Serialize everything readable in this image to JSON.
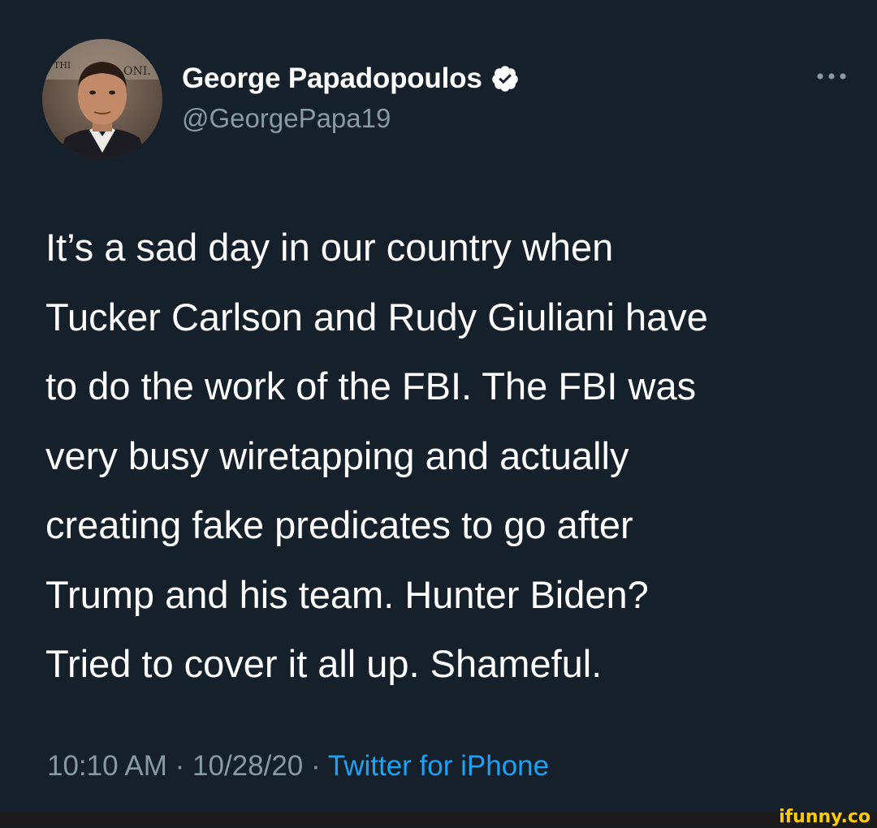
{
  "tweet": {
    "display_name": "George Papadopoulos",
    "handle": "@GeorgePapa19",
    "verified": true,
    "avatar_icon": "profile-photo",
    "more_icon": "more-dots-icon",
    "text_lines": [
      "It’s a sad day in our country when",
      "Tucker Carlson and Rudy Giuliani have",
      "to do the work of the FBI. The FBI was",
      "very busy wiretapping and actually",
      "creating fake predicates to go after",
      "Trump and his team. Hunter Biden?",
      "Tried to cover it all up. Shameful."
    ],
    "time": "10:10 AM",
    "separator": "·",
    "date": "10/28/20",
    "source": "Twitter for iPhone"
  },
  "watermark": {
    "text": "ifunny.co"
  },
  "colors": {
    "background": "#15202b",
    "text": "#ffffff",
    "secondary": "#8899a6",
    "link": "#1da1f2",
    "watermark": "#ffcc00"
  }
}
